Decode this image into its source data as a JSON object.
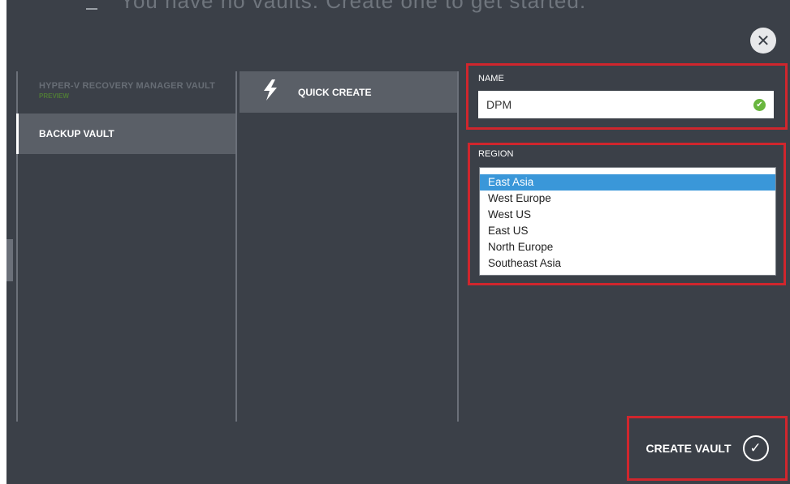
{
  "header": {
    "partial_title_text": "You have no vaults. Create one to get started."
  },
  "dialog": {
    "close_glyph": "✕",
    "vault_types": [
      {
        "label": "HYPER-V RECOVERY MANAGER VAULT",
        "badge": "PREVIEW"
      },
      {
        "label": "BACKUP VAULT"
      }
    ],
    "create_methods": [
      {
        "icon": "lightning-bolt-icon",
        "label": "QUICK CREATE"
      }
    ],
    "name_field": {
      "label": "NAME",
      "value": "DPM",
      "valid": true
    },
    "region_field": {
      "label": "REGION",
      "options": [
        "East Asia",
        "West Europe",
        "West US",
        "East US",
        "North Europe",
        "Southeast Asia"
      ],
      "selected": "East Asia"
    },
    "submit": {
      "label": "CREATE VAULT"
    }
  },
  "colors": {
    "background": "#3b4048",
    "selected_item": "#5a5f67",
    "highlight_border": "#d0262d",
    "selected_option": "#3a97d9",
    "valid_check": "#69b63e",
    "preview_badge": "#4f7a36"
  }
}
